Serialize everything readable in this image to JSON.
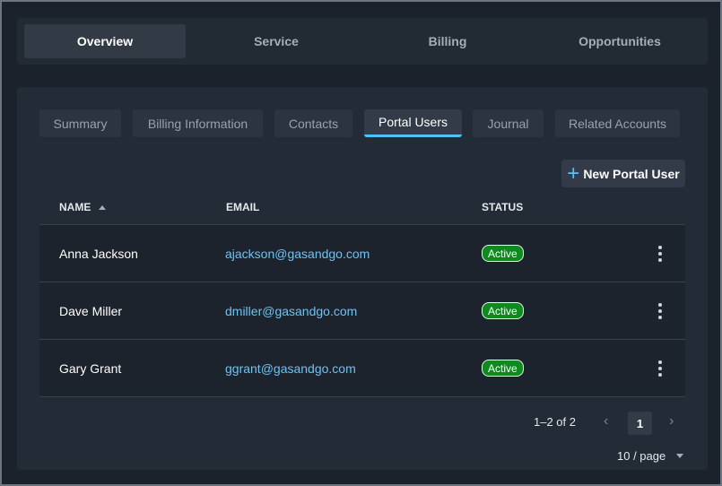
{
  "top_tabs": [
    "Overview",
    "Service",
    "Billing",
    "Opportunities"
  ],
  "active_top_tab": "Overview",
  "sub_tabs": [
    "Summary",
    "Billing Information",
    "Contacts",
    "Portal Users",
    "Journal",
    "Related Accounts"
  ],
  "active_sub_tab": "Portal Users",
  "new_button_label": "New Portal User",
  "table": {
    "columns": [
      "NAME",
      "EMAIL",
      "STATUS"
    ],
    "sorted_by": "NAME",
    "sort_direction": "ascending",
    "rows": [
      {
        "name": "Anna Jackson",
        "email": "ajackson@gasandgo.com",
        "status": "Active"
      },
      {
        "name": "Dave Miller",
        "email": "dmiller@gasandgo.com",
        "status": "Active"
      },
      {
        "name": "Gary Grant",
        "email": "ggrant@gasandgo.com",
        "status": "Active"
      }
    ]
  },
  "pagination": {
    "range_text": "1–2 of 2",
    "current_page": "1",
    "per_page": "10 / page"
  },
  "icons": {
    "add": "plus-icon",
    "sort": "sort-up-icon",
    "row_menu": "kebab-menu-icon",
    "prev": "chevron-left-icon",
    "next": "chevron-right-icon",
    "dropdown": "caret-down-icon"
  },
  "colors": {
    "accent": "#4fc3f7",
    "link": "#6fc2f0",
    "status_active": "#0f8a1e",
    "background": "#1b222c",
    "panel": "#232b36"
  }
}
